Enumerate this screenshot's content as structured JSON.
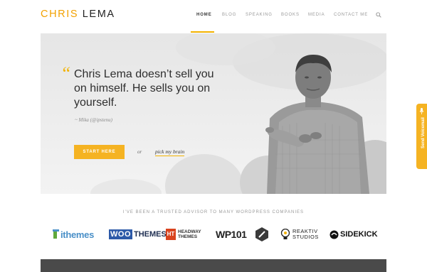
{
  "site": {
    "logo_first": "CHRIS",
    "logo_last": "LEMA"
  },
  "nav": {
    "items": [
      {
        "label": "HOME",
        "active": true
      },
      {
        "label": "BLOG",
        "active": false
      },
      {
        "label": "SPEAKING",
        "active": false
      },
      {
        "label": "BOOKS",
        "active": false
      },
      {
        "label": "MEDIA",
        "active": false
      },
      {
        "label": "CONTACT ME",
        "active": false
      }
    ],
    "search_icon": "search-icon"
  },
  "hero": {
    "quote_mark": "“",
    "quote": "Chris Lema doesn’t sell you on himself. He sells you on yourself.",
    "cite": "~ Mika (@ipstenu)",
    "start_button": "START HERE",
    "or": "or",
    "pick_link": "pick my brain"
  },
  "advisor": {
    "heading": "I’VE BEEN A TRUSTED ADVISOR TO MANY WORDPRESS COMPANIES",
    "logos": [
      {
        "name": "ithemes",
        "text": "ithemes"
      },
      {
        "name": "woothemes",
        "text_a": "WOO",
        "text_b": "THEMES"
      },
      {
        "name": "headway",
        "mark": "HT",
        "text_a": "HEADWAY",
        "text_b": "THEMES"
      },
      {
        "name": "wp101",
        "text": "WP101"
      },
      {
        "name": "pen-badge"
      },
      {
        "name": "reaktiv",
        "text_a": "REAKTIV",
        "text_b": "STUDIOS"
      },
      {
        "name": "sidekick",
        "text": "SIDEKICK"
      }
    ]
  },
  "side_tab": {
    "label": "Send Voicemail",
    "icon": "microphone-icon"
  },
  "colors": {
    "accent": "#f5b322",
    "text": "#2e2e2e"
  }
}
